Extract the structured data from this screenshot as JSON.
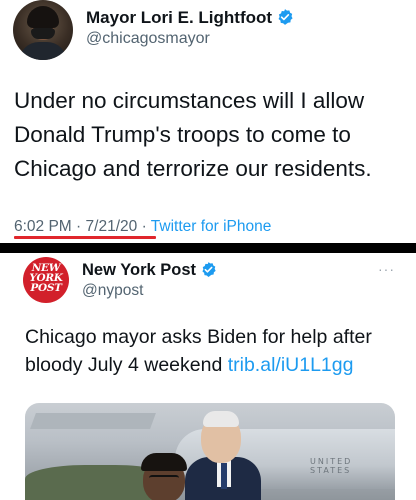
{
  "tweet1": {
    "author_name": "Mayor Lori E. Lightfoot",
    "handle": "@chicagosmayor",
    "text": "Under no circumstances will I allow Donald Trump's troops to come to Chicago and terrorize our residents.",
    "time": "6:02 PM",
    "separator": "·",
    "date": "7/21/20",
    "source": "Twitter for iPhone",
    "verified": true,
    "highlight_color": "#e0262c"
  },
  "tweet2": {
    "author_name": "New York Post",
    "handle": "@nypost",
    "avatar_logo_lines": [
      "NEW",
      "YORK",
      "POST"
    ],
    "more_label": "···",
    "text": "Chicago mayor asks Biden for help after bloody July 4 weekend",
    "link": "trib.al/iU1L1gg",
    "verified": true,
    "photo_text": "UNITED STATES",
    "brand_color": "#d2202b"
  },
  "colors": {
    "link": "#1d9bf0",
    "secondary_text": "#536471",
    "divider": "#000000"
  }
}
